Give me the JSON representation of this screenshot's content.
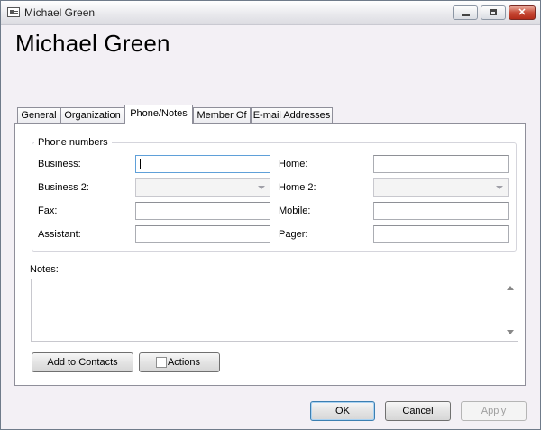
{
  "window": {
    "title": "Michael Green"
  },
  "heading": "Michael Green",
  "tabs": [
    {
      "label": "General"
    },
    {
      "label": "Organization"
    },
    {
      "label": "Phone/Notes"
    },
    {
      "label": "Member Of"
    },
    {
      "label": "E-mail Addresses"
    }
  ],
  "active_tab": "Phone/Notes",
  "phone_group": {
    "title": "Phone numbers",
    "business": {
      "label": "Business:",
      "value": ""
    },
    "business2": {
      "label": "Business 2:",
      "value": ""
    },
    "fax": {
      "label": "Fax:",
      "value": ""
    },
    "assistant": {
      "label": "Assistant:",
      "value": ""
    },
    "home": {
      "label": "Home:",
      "value": ""
    },
    "home2": {
      "label": "Home 2:",
      "value": ""
    },
    "mobile": {
      "label": "Mobile:",
      "value": ""
    },
    "pager": {
      "label": "Pager:",
      "value": ""
    }
  },
  "notes": {
    "label": "Notes:",
    "value": ""
  },
  "buttons": {
    "add_to_contacts": "Add to Contacts",
    "actions": "Actions",
    "ok": "OK",
    "cancel": "Cancel",
    "apply": "Apply"
  },
  "icons": {
    "app": "contact-card-icon",
    "minimize": "minimize-icon",
    "maximize": "maximize-icon",
    "close": "close-icon"
  }
}
